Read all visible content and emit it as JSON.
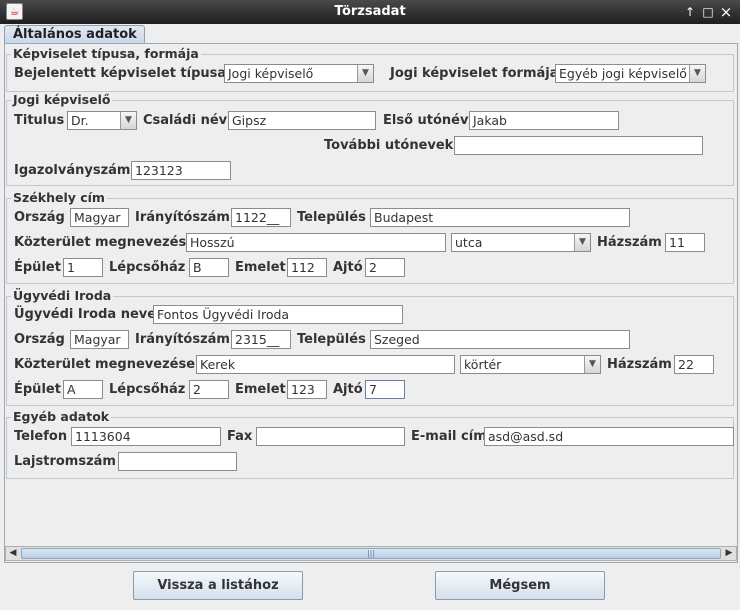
{
  "window": {
    "title": "Törzsadat",
    "app_icon": "java-icon",
    "controls": {
      "pin": "↑",
      "maximize": "□",
      "close": "×"
    }
  },
  "tab": {
    "label": "Általános adatok"
  },
  "representative": {
    "title": "Képviselet típusa, formája",
    "registered_type_label": "Bejelentett képviselet típusa",
    "registered_type_value": "Jogi képviselő",
    "legal_form_label": "Jogi képviselet formája",
    "legal_form_value": "Egyéb jogi képviselő"
  },
  "legal_rep": {
    "title": "Jogi képviselő",
    "titulus_label": "Titulus",
    "titulus_value": "Dr.",
    "family_name_label": "Családi név",
    "family_name_value": "Gipsz",
    "first_name_label": "Első utónév",
    "first_name_value": "Jakab",
    "other_names_label": "További utónevek",
    "other_names_value": "",
    "id_number_label": "Igazolványszám",
    "id_number_value": "123123"
  },
  "seat": {
    "title": "Székhely cím",
    "country_label": "Ország",
    "country_value": "Magyar",
    "zip_label": "Irányítószám",
    "zip_value": "1122__",
    "city_label": "Település",
    "city_value": "Budapest",
    "street_label": "Közterület megnevezés",
    "street_value": "Hosszú",
    "street_type_value": "utca",
    "house_no_label": "Házszám",
    "house_no_value": "11",
    "building_label": "Épület",
    "building_value": "1",
    "staircase_label": "Lépcsőház",
    "staircase_value": "B",
    "floor_label": "Emelet",
    "floor_value": "112",
    "door_label": "Ajtó",
    "door_value": "2"
  },
  "office": {
    "title": "Ügyvédi Iroda",
    "name_label": "Ügyvédi Iroda neve",
    "name_value": "Fontos Ügyvédi Iroda",
    "country_label": "Ország",
    "country_value": "Magyar",
    "zip_label": "Irányítószám",
    "zip_value": "2315__",
    "city_label": "Település",
    "city_value": "Szeged",
    "street_label": "Közterület megnevezése",
    "street_value": "Kerek",
    "street_type_value": "körtér",
    "house_no_label": "Házszám",
    "house_no_value": "22",
    "building_label": "Épület",
    "building_value": "A",
    "staircase_label": "Lépcsőház",
    "staircase_value": "2",
    "floor_label": "Emelet",
    "floor_value": "123",
    "door_label": "Ajtó",
    "door_value": "7"
  },
  "other": {
    "title": "Egyéb adatok",
    "phone_label": "Telefon",
    "phone_value": "1113604",
    "fax_label": "Fax",
    "fax_value": "",
    "email_label": "E-mail cím",
    "email_value": "asd@asd.sd",
    "registry_label": "Lajstromszám",
    "registry_value": ""
  },
  "buttons": {
    "back_label": "Vissza a listához",
    "cancel_label": "Mégsem"
  },
  "colors": {
    "titlebar": "#2a2a2a",
    "background": "#eeeeee",
    "tab_accent": "#c8d8ea",
    "button_accent": "#d4e0ec"
  }
}
